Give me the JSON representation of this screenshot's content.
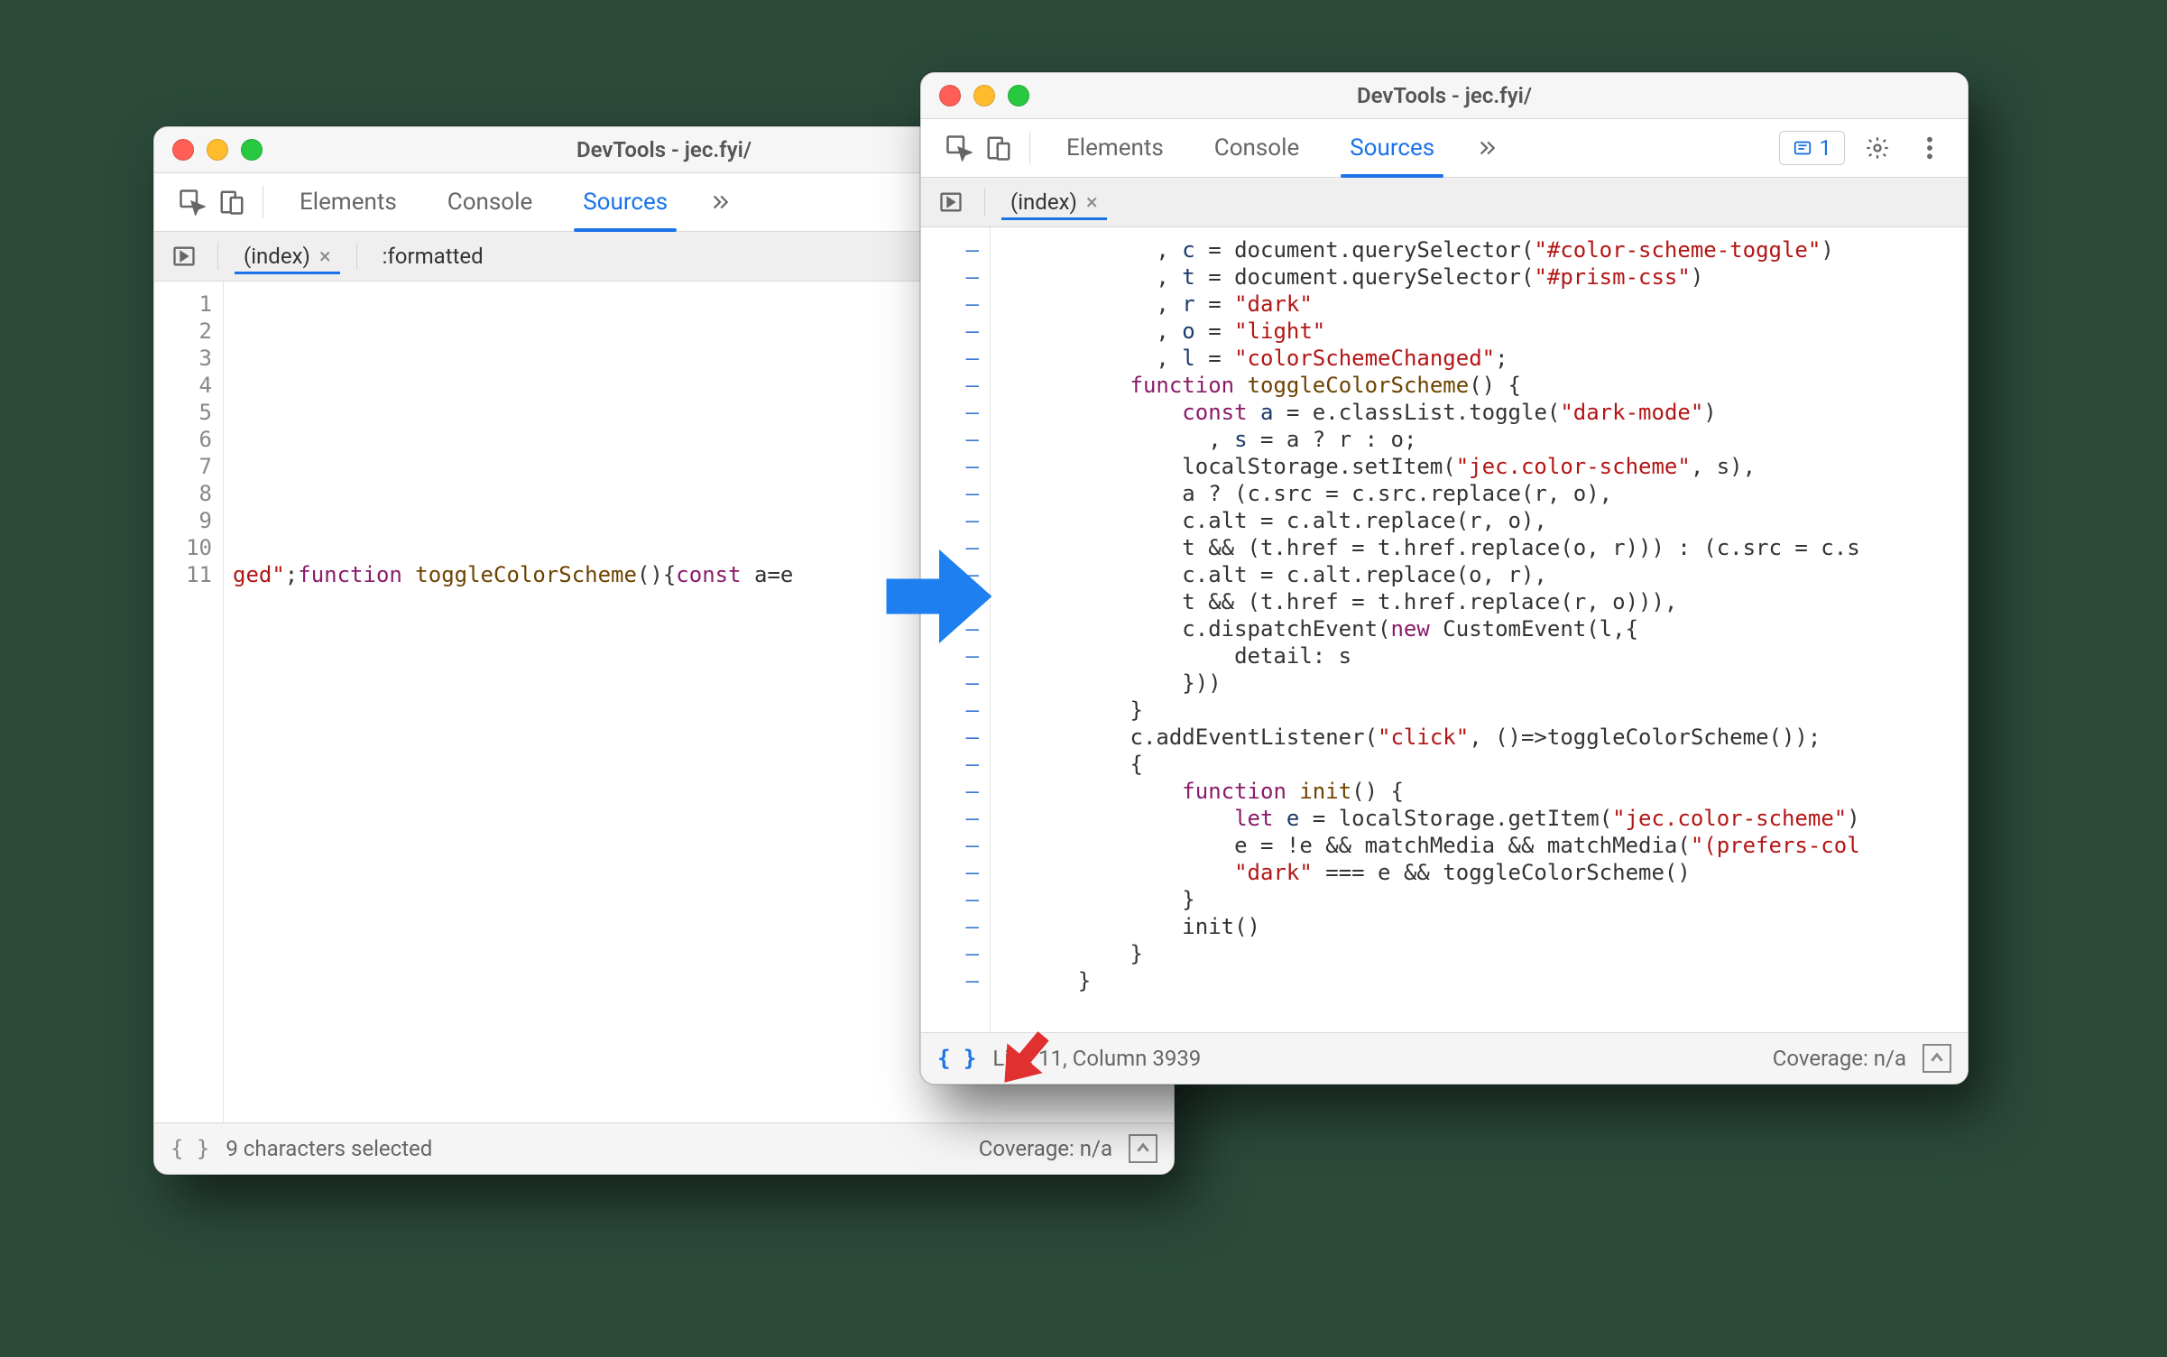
{
  "left": {
    "title": "DevTools - jec.fyi/",
    "tabs": {
      "elements": "Elements",
      "console": "Console",
      "sources": "Sources"
    },
    "file_tabs": {
      "index": "(index)",
      "formatted": ":formatted"
    },
    "gutter": [
      "1",
      "2",
      "3",
      "4",
      "5",
      "6",
      "7",
      "8",
      "9",
      "10",
      "11"
    ],
    "line11_html": "<span class='str'>ged\"</span><span class='punct'>;</span><span class='kw'>function</span> <span class='fn'>toggleColorScheme</span><span class='punct'>(){</span><span class='kw'>const</span> a=e",
    "status": {
      "pretty": "{ }",
      "selected": "9 characters selected",
      "coverage": "Coverage: n/a"
    }
  },
  "right": {
    "title": "DevTools - jec.fyi/",
    "tabs": {
      "elements": "Elements",
      "console": "Console",
      "sources": "Sources"
    },
    "badge_count": "1",
    "file_tabs": {
      "index": "(index)"
    },
    "code_lines": [
      "            , <span class='id'>c</span> = document.querySelector(<span class='str'>\"#color-scheme-toggle\"</span>)",
      "            , <span class='id'>t</span> = document.querySelector(<span class='str'>\"#prism-css\"</span>)",
      "            , <span class='id'>r</span> = <span class='str'>\"dark\"</span>",
      "            , <span class='id'>o</span> = <span class='str'>\"light\"</span>",
      "            , <span class='id'>l</span> = <span class='str'>\"colorSchemeChanged\"</span>;",
      "          <span class='kw'>function</span> <span class='fn'>toggleColorScheme</span>() {",
      "              <span class='kw'>const</span> <span class='id'>a</span> = e.classList.toggle(<span class='str'>\"dark-mode\"</span>)",
      "                , <span class='id'>s</span> = a ? r : o;",
      "              localStorage.setItem(<span class='str'>\"jec.color-scheme\"</span>, s),",
      "              a ? (c.src = c.src.replace(r, o),",
      "              c.alt = c.alt.replace(r, o),",
      "              t && (t.href = t.href.replace(o, r))) : (c.src = c.s",
      "              c.alt = c.alt.replace(o, r),",
      "              t && (t.href = t.href.replace(r, o))),",
      "              c.dispatchEvent(<span class='kw'>new</span> CustomEvent(l,{",
      "                  detail: s",
      "              }))",
      "          }",
      "          c.addEventListener(<span class='str'>\"click\"</span>, ()=&gt;toggleColorScheme());",
      "          {",
      "              <span class='kw'>function</span> <span class='fn'>init</span>() {",
      "                  <span class='kw'>let</span> <span class='id'>e</span> = localStorage.getItem(<span class='str'>\"jec.color-scheme\"</span>)",
      "                  e = !e && matchMedia && matchMedia(<span class='str'>\"(prefers-col</span>",
      "                  <span class='str'>\"dark\"</span> === e && toggleColorScheme()",
      "              }",
      "              init()",
      "          }",
      "      }"
    ],
    "status": {
      "pretty": "{ }",
      "line": "Line 11, Column 3939",
      "coverage": "Coverage: n/a"
    }
  }
}
